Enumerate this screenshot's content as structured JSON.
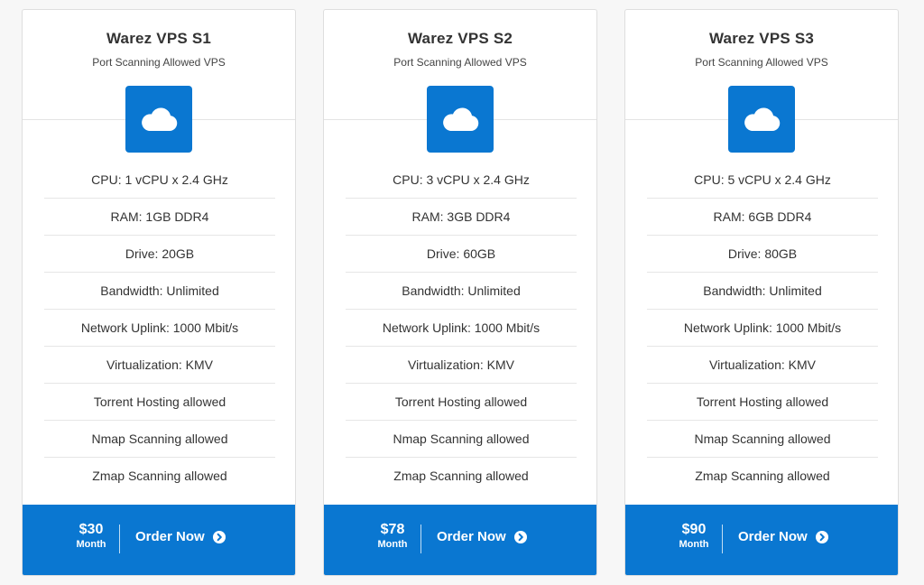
{
  "plans": [
    {
      "title": "Warez VPS S1",
      "subtitle": "Port Scanning Allowed VPS",
      "icon": "cloud-icon",
      "features": [
        "CPU: 1 vCPU x 2.4 GHz",
        "RAM: 1GB DDR4",
        "Drive: 20GB",
        "Bandwidth: Unlimited",
        "Network Uplink: 1000 Mbit/s",
        "Virtualization: KMV",
        "Torrent Hosting allowed",
        "Nmap Scanning allowed",
        "Zmap Scanning allowed"
      ],
      "price": "$30",
      "period": "Month",
      "order_label": "Order Now"
    },
    {
      "title": "Warez VPS S2",
      "subtitle": "Port Scanning Allowed VPS",
      "icon": "cloud-icon",
      "features": [
        "CPU: 3 vCPU x 2.4 GHz",
        "RAM: 3GB DDR4",
        "Drive: 60GB",
        "Bandwidth: Unlimited",
        "Network Uplink: 1000 Mbit/s",
        "Virtualization: KMV",
        "Torrent Hosting allowed",
        "Nmap Scanning allowed",
        "Zmap Scanning allowed"
      ],
      "price": "$78",
      "period": "Month",
      "order_label": "Order Now"
    },
    {
      "title": "Warez VPS S3",
      "subtitle": "Port Scanning Allowed VPS",
      "icon": "cloud-icon",
      "features": [
        "CPU: 5 vCPU x 2.4 GHz",
        "RAM: 6GB DDR4",
        "Drive: 80GB",
        "Bandwidth: Unlimited",
        "Network Uplink: 1000 Mbit/s",
        "Virtualization: KMV",
        "Torrent Hosting allowed",
        "Nmap Scanning allowed",
        "Zmap Scanning allowed"
      ],
      "price": "$90",
      "period": "Month",
      "order_label": "Order Now"
    }
  ],
  "colors": {
    "accent": "#0a77d1",
    "text": "#333333",
    "divider": "#e6e6e6"
  },
  "order_icon": "arrow-right-circle-icon"
}
